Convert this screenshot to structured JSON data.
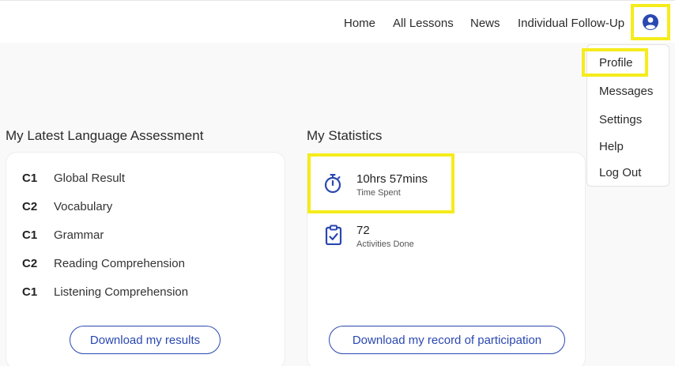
{
  "nav": {
    "links": [
      "Home",
      "All Lessons",
      "News",
      "Individual Follow-Up"
    ],
    "avatar_icon": "user-circle-icon"
  },
  "user_menu": {
    "items": [
      "Profile",
      "Messages",
      "Settings",
      "Help",
      "Log Out"
    ]
  },
  "assessment": {
    "title": "My Latest Language Assessment",
    "rows": [
      {
        "level": "C1",
        "skill": "Global Result"
      },
      {
        "level": "C2",
        "skill": "Vocabulary"
      },
      {
        "level": "C1",
        "skill": "Grammar"
      },
      {
        "level": "C2",
        "skill": "Reading Comprehension"
      },
      {
        "level": "C1",
        "skill": "Listening Comprehension"
      }
    ],
    "download_label": "Download my results"
  },
  "statistics": {
    "title": "My Statistics",
    "time_value": "10hrs 57mins",
    "time_label": "Time Spent",
    "time_icon": "stopwatch-icon",
    "activities_value": "72",
    "activities_label": "Activities Done",
    "activities_icon": "clipboard-check-icon",
    "download_label": "Download my record of participation"
  },
  "colors": {
    "accent": "#2a48b0",
    "highlight": "#f5ec1b"
  }
}
